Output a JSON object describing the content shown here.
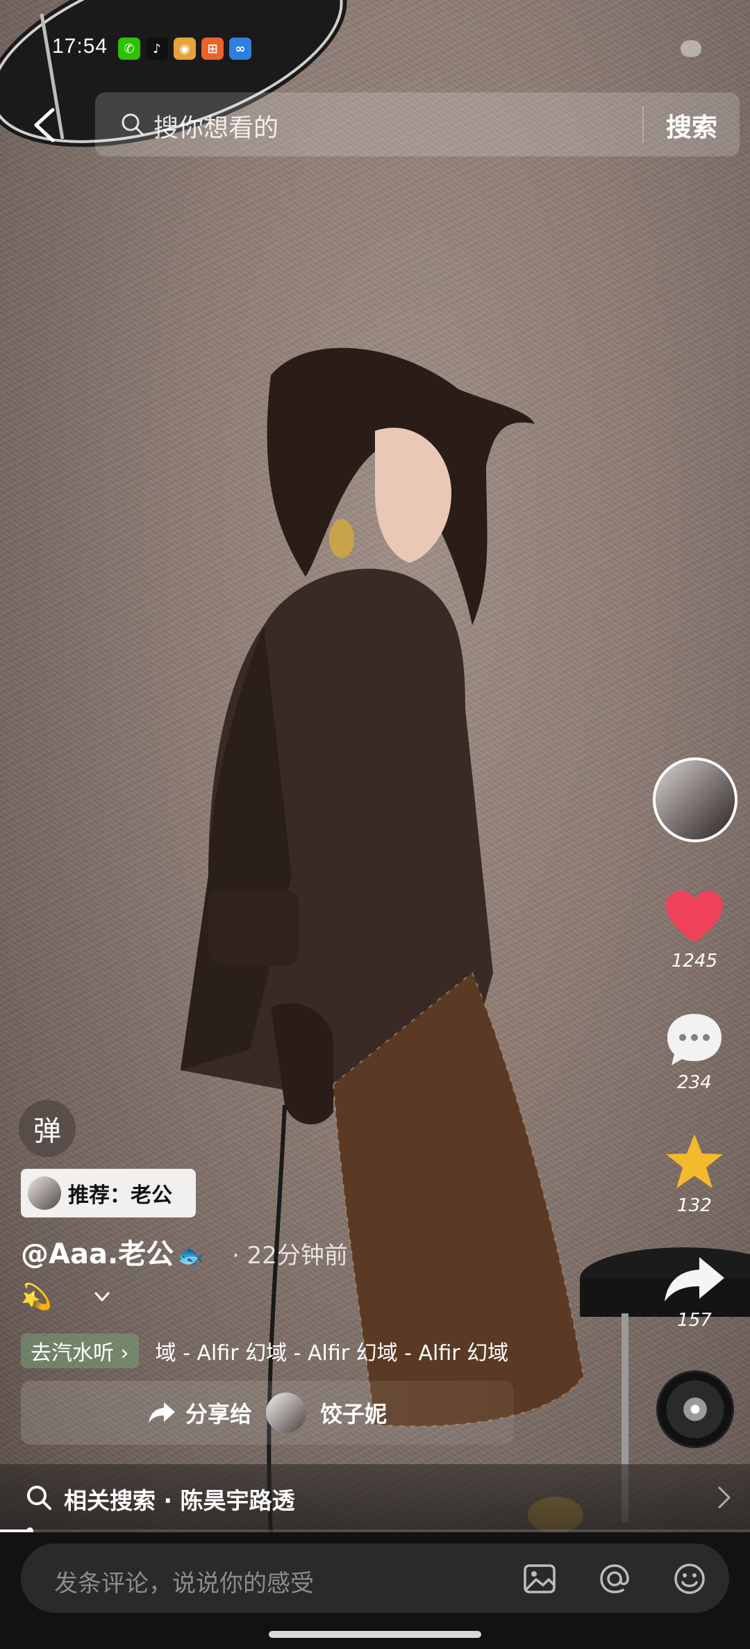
{
  "status_bar": {
    "time": "17:54",
    "notification_icons": [
      {
        "name": "wechat-icon",
        "color": "#2dc100",
        "glyph": "✆"
      },
      {
        "name": "tiktok-icon",
        "color": "#111111",
        "glyph": "♪"
      },
      {
        "name": "weibo-icon",
        "color": "#e6a23c",
        "glyph": "◉"
      },
      {
        "name": "app-orange-icon",
        "color": "#e8642a",
        "glyph": "⊞"
      },
      {
        "name": "app-blue-icon",
        "color": "#2f7fe0",
        "glyph": "∞"
      }
    ]
  },
  "search": {
    "placeholder": "搜你想看的",
    "button_label": "搜索"
  },
  "actions": {
    "like_count": "1245",
    "comment_count": "234",
    "favorite_count": "132",
    "share_count": "157"
  },
  "post": {
    "danmu_label": "弹",
    "recommend_label": "推荐：老公",
    "author": "@Aaa.老公",
    "author_emoji": "🐟",
    "time_ago": "· 22分钟前",
    "desc_emoji": "💫"
  },
  "music": {
    "chip_label": "去汽水听 ›",
    "marquee": "域 - Alfir    幻域 - Alfir    幻域 - Alfir    幻域"
  },
  "share": {
    "label": "分享给",
    "name": "饺子妮"
  },
  "related_search": {
    "text": "相关搜索 · 陈昊宇路透"
  },
  "progress": {
    "fraction": 0.04
  },
  "comment": {
    "placeholder": "发条评论，说说你的感受"
  },
  "colors": {
    "like": "#f0415a",
    "favorite": "#f5b92e",
    "accent_bg": "#121212"
  }
}
